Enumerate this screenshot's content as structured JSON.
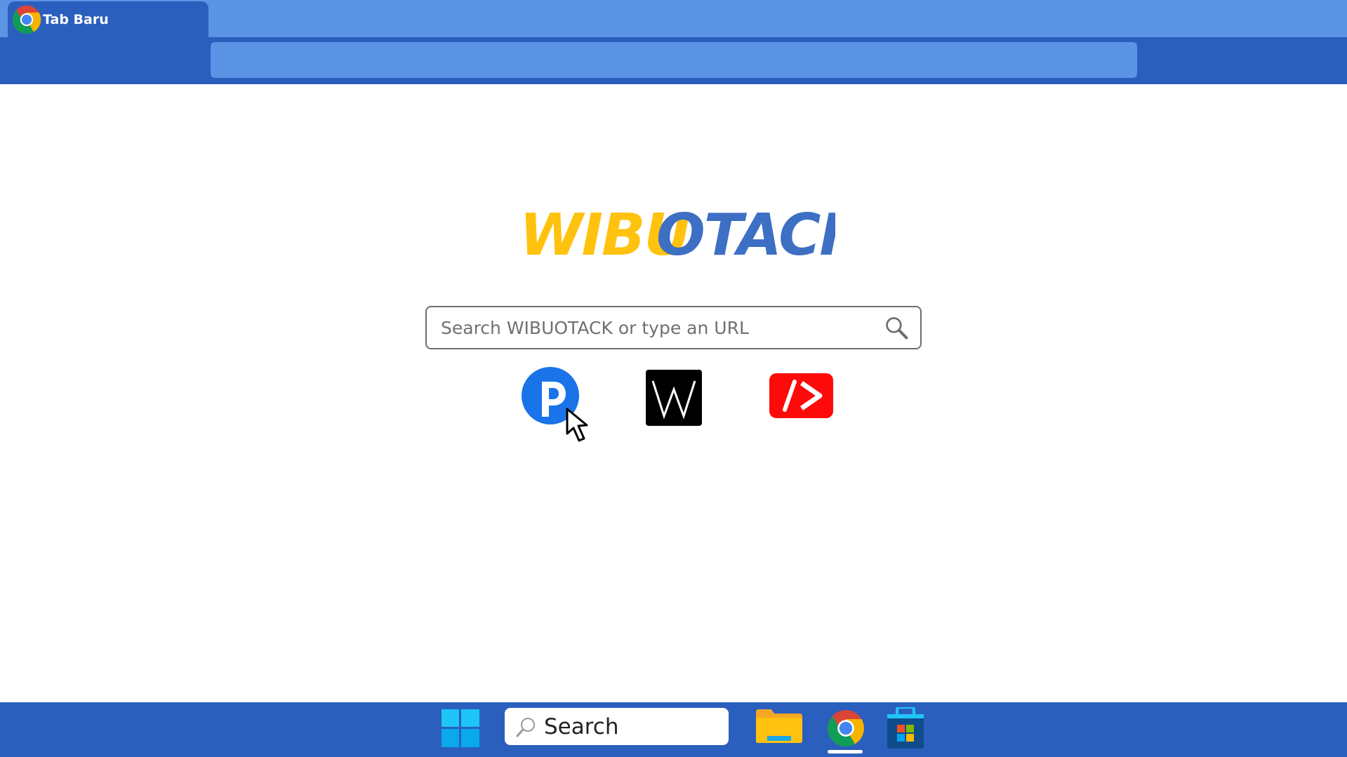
{
  "browser": {
    "tab_title": "Tab Baru",
    "tab_icon": "chrome-icon",
    "address_value": ""
  },
  "page": {
    "logo": {
      "part1": "WIBU",
      "part2": "OTACK!",
      "color_part1": "#ffc20e",
      "color_part2": "#3d6fc4"
    },
    "search": {
      "placeholder": "Search WIBUOTACK or type an URL",
      "icon": "search-icon"
    },
    "shortcuts": [
      {
        "name": "p-logo-shortcut",
        "icon": "blue-circle-p-icon",
        "color": "#1a73e8"
      },
      {
        "name": "w-logo-shortcut",
        "icon": "black-square-w-icon",
        "color": "#000000"
      },
      {
        "name": "red-code-shortcut",
        "icon": "red-slash-arrow-icon",
        "color": "#ff0a0a"
      }
    ]
  },
  "taskbar": {
    "search_label": "Search",
    "items": [
      "windows-start-icon",
      "search-box",
      "file-explorer-icon",
      "chrome-icon",
      "microsoft-store-icon"
    ],
    "active_item": "chrome-icon",
    "background": "#2b5fbe"
  }
}
